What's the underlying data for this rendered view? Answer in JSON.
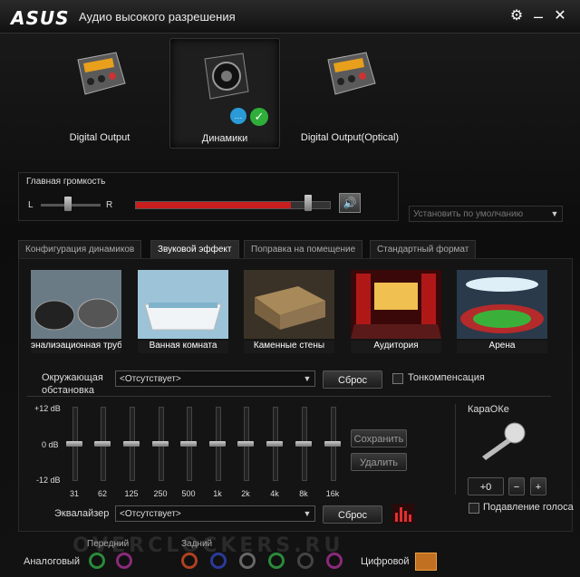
{
  "window": {
    "logo": "ASUS",
    "title": "Аудио высокого разрешения"
  },
  "devices": [
    {
      "label": "Digital Output"
    },
    {
      "label": "Динамики"
    },
    {
      "label": "Digital Output(Optical)"
    }
  ],
  "volume": {
    "title": "Главная громкость",
    "left": "L",
    "right": "R",
    "level": 0.8
  },
  "default_select": {
    "value": "Установить по умолчанию"
  },
  "tabs": [
    {
      "label": "Конфигурация динамиков"
    },
    {
      "label": "Звуковой эффект"
    },
    {
      "label": "Поправка на помещение"
    },
    {
      "label": "Стандартный формат"
    }
  ],
  "effects": [
    {
      "label": "Канализационная труба",
      "shown": "эналиэационная труб"
    },
    {
      "label": "Ванная комната"
    },
    {
      "label": "Каменные стены"
    },
    {
      "label": "Аудитория"
    },
    {
      "label": "Арена"
    }
  ],
  "environment": {
    "label_line1": "Окружающая",
    "label_line2": "обстановка",
    "value": "<Отсутствует>",
    "reset": "Сброс",
    "loudness": "Тонкомпенсация"
  },
  "eq": {
    "db_top": "+12 dB",
    "db_mid": "0 dB",
    "db_bottom": "-12 dB",
    "bands": [
      "31",
      "62",
      "125",
      "250",
      "500",
      "1k",
      "2k",
      "4k",
      "8k",
      "16k"
    ],
    "save": "Сохранить",
    "delete": "Удалить",
    "label": "Эквалайзер",
    "value": "<Отсутствует>",
    "reset": "Сброс"
  },
  "karaoke": {
    "title": "КараОКе",
    "value": "+0",
    "minus": "−",
    "plus": "+",
    "suppress": "Подавление голоса"
  },
  "bottom": {
    "analog": "Аналоговый",
    "front": "Передний",
    "rear": "Задний",
    "digital": "Цифровой",
    "watermark": "OVERCLOCKERS.RU"
  },
  "colors": {
    "accent_red": "#c81e1e",
    "check_green": "#2fae3a"
  }
}
